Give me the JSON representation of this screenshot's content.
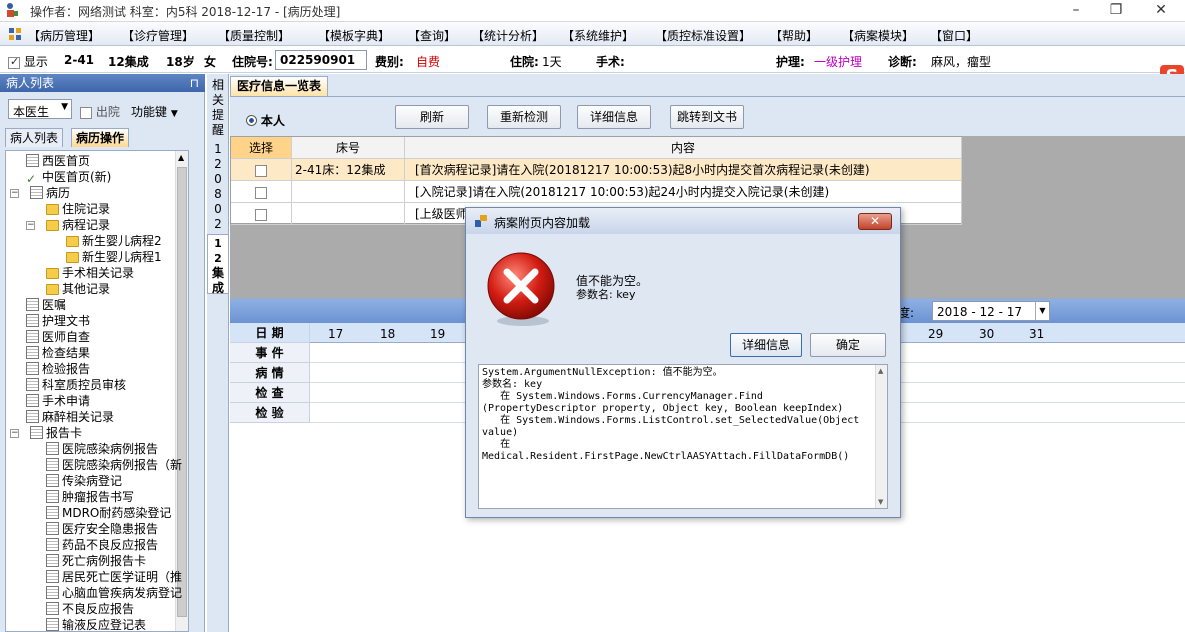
{
  "titlebar": {
    "title": "操作者：网络测试  科室：内5科  2018-12-17 - [病历处理]",
    "minimize": "–",
    "restore": "❐",
    "close": "✕"
  },
  "menu": [
    "【病历管理】",
    "【诊疗管理】",
    "【质量控制】",
    "【模板字典】",
    "【查询】",
    "【统计分析】",
    "【系统维护】",
    "【质控标准设置】",
    "【帮助】",
    "【病案模块】",
    "【窗口】"
  ],
  "patient": {
    "show_label": "显示",
    "bed": "2-41",
    "name": "12集成",
    "age": "18岁",
    "sex": "女",
    "admission_label": "住院号:",
    "admission_no": "022590901",
    "fee_label": "费别:",
    "fee": "自费",
    "stay_label": "住院:",
    "stay": "1天",
    "surgery_label": "手术:",
    "nursing_label": "护理:",
    "nursing": "一级护理",
    "diag_label": "诊断:",
    "diagnosis": "麻风，瘤型"
  },
  "colors": {
    "accent": "#3d66aa",
    "fee": "#d40000",
    "nursing": "#c000c0",
    "highlight_row": "#fde9c5"
  },
  "left_panel": {
    "header": "病人列表",
    "pin": "⊓",
    "doctor_select": "本医生",
    "discharged_label": "出院",
    "function_key": "功能键",
    "tab_patient_list": "病人列表",
    "tab_record_ops": "病历操作",
    "tree": [
      {
        "label": "西医首页",
        "level": 1,
        "icon": "doc"
      },
      {
        "label": "中医首页(新)",
        "level": 1,
        "icon": "check"
      },
      {
        "label": "病历",
        "level": 0,
        "icon": "doc",
        "exp": "−"
      },
      {
        "label": "住院记录",
        "level": 2,
        "icon": "folder"
      },
      {
        "label": "病程记录",
        "level": 2,
        "icon": "folder",
        "exp": "−"
      },
      {
        "label": "新生婴儿病程2",
        "level": 3,
        "icon": "folder"
      },
      {
        "label": "新生婴儿病程1",
        "level": 3,
        "icon": "folder"
      },
      {
        "label": "手术相关记录",
        "level": 2,
        "icon": "folder"
      },
      {
        "label": "其他记录",
        "level": 2,
        "icon": "folder"
      },
      {
        "label": "医嘱",
        "level": 1,
        "icon": "doc"
      },
      {
        "label": "护理文书",
        "level": 1,
        "icon": "doc",
        "exp": "+"
      },
      {
        "label": "医师自查",
        "level": 1,
        "icon": "doc"
      },
      {
        "label": "检查结果",
        "level": 1,
        "icon": "doc"
      },
      {
        "label": "检验报告",
        "level": 1,
        "icon": "doc"
      },
      {
        "label": "科室质控员审核",
        "level": 1,
        "icon": "doc"
      },
      {
        "label": "手术申请",
        "level": 1,
        "icon": "doc"
      },
      {
        "label": "麻醉相关记录",
        "level": 1,
        "icon": "doc"
      },
      {
        "label": "报告卡",
        "level": 0,
        "icon": "doc",
        "exp": "−"
      },
      {
        "label": "医院感染病例报告",
        "level": 2,
        "icon": "doc"
      },
      {
        "label": "医院感染病例报告（新",
        "level": 2,
        "icon": "doc"
      },
      {
        "label": "传染病登记",
        "level": 2,
        "icon": "doc"
      },
      {
        "label": "肿瘤报告书写",
        "level": 2,
        "icon": "doc"
      },
      {
        "label": "MDRO耐药感染登记",
        "level": 2,
        "icon": "doc"
      },
      {
        "label": "医疗安全隐患报告",
        "level": 2,
        "icon": "doc"
      },
      {
        "label": "药品不良反应报告",
        "level": 2,
        "icon": "doc"
      },
      {
        "label": "死亡病例报告卡",
        "level": 2,
        "icon": "doc"
      },
      {
        "label": "居民死亡医学证明（推",
        "level": 2,
        "icon": "doc"
      },
      {
        "label": "心脑血管疾病发病登记",
        "level": 2,
        "icon": "doc"
      },
      {
        "label": "不良反应报告",
        "level": 2,
        "icon": "doc"
      },
      {
        "label": "输液反应登记表",
        "level": 2,
        "icon": "doc"
      }
    ]
  },
  "side_tab": {
    "reminder": [
      "相",
      "关",
      "提",
      "醒"
    ],
    "digits": [
      "1",
      "2",
      "0",
      "8",
      "0",
      "2"
    ],
    "name": [
      "1",
      "2",
      "集",
      "成"
    ]
  },
  "main": {
    "tab": "医疗信息一览表",
    "radio_self": "本人",
    "buttons": [
      "刷新",
      "重新检测",
      "详细信息",
      "跳转到文书"
    ],
    "table": {
      "headers": [
        "选择",
        "床号",
        "内容"
      ],
      "rows": [
        {
          "bed": "2-41床：12集成",
          "content": "[首次病程记录]请在入院(20181217  10:00:53)起8小时内提交首次病程记录(未创建)"
        },
        {
          "bed": "",
          "content": "[入院记录]请在入院(20181217  10:00:53)起24小时内提交入院记录(未创建)"
        },
        {
          "bed": "",
          "content": "[上级医师"
        }
      ]
    },
    "calendar": {
      "week_label": "度:",
      "date": "2018 - 12 - 17",
      "row_labels": [
        "日  期",
        "事  件",
        "病  情",
        "检  查",
        "检  验"
      ],
      "days_left": [
        "17",
        "18",
        "19"
      ],
      "days_right": [
        "29",
        "30",
        "31"
      ]
    }
  },
  "dialog": {
    "title": "病案附页内容加载",
    "close": "✕",
    "message": "值不能为空。",
    "param": "参数名: key",
    "btn_details": "详细信息",
    "btn_ok": "确定",
    "trace": "System.ArgumentNullException: 值不能为空。\n参数名: key\n   在 System.Windows.Forms.CurrencyManager.Find\n(PropertyDescriptor property, Object key, Boolean keepIndex)\n   在 System.Windows.Forms.ListControl.set_SelectedValue(Object\nvalue)\n   在\nMedical.Resident.FirstPage.NewCtrlAASYAttach.FillDataFormDB()"
  },
  "ime": {
    "label": "S"
  }
}
